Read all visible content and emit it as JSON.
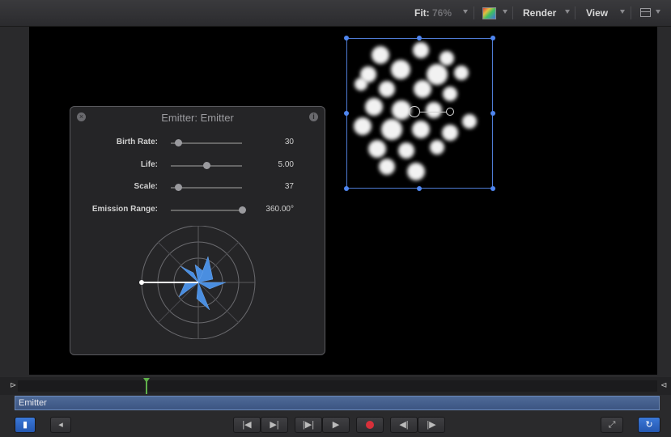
{
  "toolbar": {
    "fit_label": "Fit:",
    "fit_value": "76%",
    "render_label": "Render",
    "view_label": "View",
    "icons": [
      "color-channel-icon",
      "layout-icon"
    ]
  },
  "hud": {
    "title": "Emitter: Emitter",
    "params": [
      {
        "label": "Birth Rate:",
        "value": "30",
        "level": 0.1
      },
      {
        "label": "Life:",
        "value": "5.00",
        "level": 0.5
      },
      {
        "label": "Scale:",
        "value": "37",
        "level": 0.1
      },
      {
        "label": "Emission Range:",
        "value": "360.00°",
        "level": 1.0
      }
    ]
  },
  "timeline": {
    "layer_name": "Emitter"
  },
  "transport": {
    "buttons": [
      "play-range-icon",
      "mute-icon",
      "go-to-start-icon",
      "go-to-end-icon",
      "step-back-icon",
      "play-icon",
      "record-icon",
      "previous-frame-icon",
      "next-frame-icon",
      "fullscreen-icon",
      "loop-icon"
    ]
  },
  "colors": {
    "accent": "#3b78d8",
    "handle": "#4f86f0",
    "playhead": "#5fb04a",
    "record": "#d8303a",
    "emitter_shape": "#4a8ee0"
  }
}
